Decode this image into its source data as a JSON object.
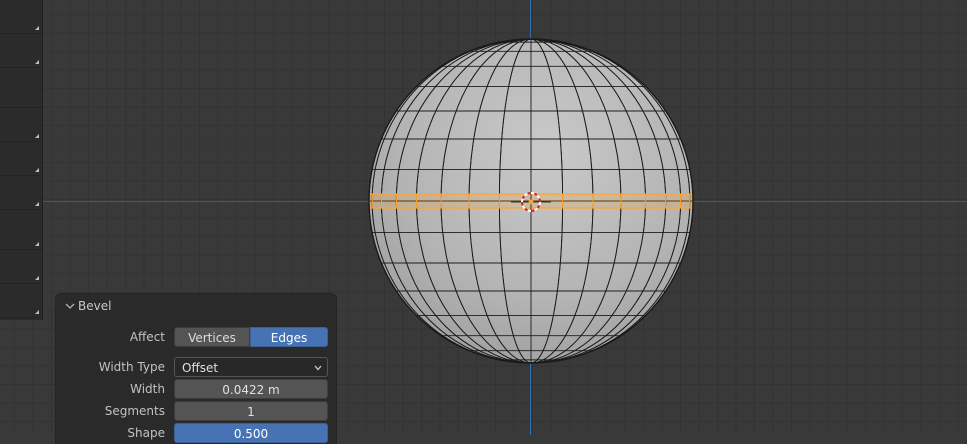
{
  "panel": {
    "title": "Bevel",
    "affect": {
      "label": "Affect",
      "options": [
        "Vertices",
        "Edges"
      ],
      "selected": "Edges"
    },
    "width_type": {
      "label": "Width Type",
      "value": "Offset"
    },
    "width": {
      "label": "Width",
      "value": "0.0422 m"
    },
    "segments": {
      "label": "Segments",
      "value": "1"
    },
    "shape": {
      "label": "Shape",
      "value": "0.500"
    }
  },
  "colors": {
    "viewport_bg": "#393939",
    "x_axis": "#9b3440",
    "y_axis": "#2f6fae",
    "selection": "#ffa52a",
    "accent": "#4772b3"
  }
}
